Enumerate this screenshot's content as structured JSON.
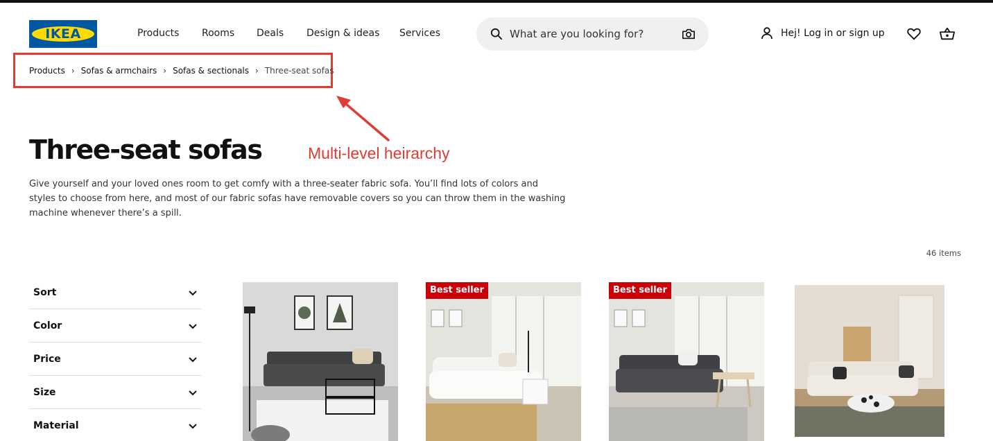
{
  "brand": {
    "logo_text": "IKEA",
    "colors": {
      "blue": "#0058a3",
      "yellow": "#ffdb00",
      "badge_red": "#cc0008",
      "annotation_red": "#e23b32"
    }
  },
  "nav": {
    "items": [
      "Products",
      "Rooms",
      "Deals",
      "Design & ideas",
      "Services"
    ]
  },
  "search": {
    "placeholder": "What are you looking for?",
    "icon": "search-icon",
    "camera_icon": "camera-icon"
  },
  "account": {
    "label": "Hej! Log in or sign up",
    "icon": "user-icon"
  },
  "icons": {
    "favorites": "heart-icon",
    "cart": "shopping-basket-icon"
  },
  "breadcrumb": {
    "items": [
      "Products",
      "Sofas & armchairs",
      "Sofas & sectionals"
    ],
    "current": "Three-seat sofas",
    "separator": "›"
  },
  "annotation": {
    "text": "Multi-level heirarchy"
  },
  "page": {
    "title": "Three-seat sofas",
    "description_lines": [
      "Give yourself and your loved ones room to get comfy with a three-seater fabric sofa. You’ll find lots of colors and",
      "styles to choose from here, and most of our fabric sofas have removable covers so you can throw them in the washing",
      "machine whenever there’s a spill."
    ],
    "item_count": "46 items"
  },
  "filters": [
    "Sort",
    "Color",
    "Price",
    "Size",
    "Material"
  ],
  "products": [
    {
      "badge": "",
      "sofa_color": "dark-gray"
    },
    {
      "badge": "Best seller",
      "sofa_color": "white"
    },
    {
      "badge": "Best seller",
      "sofa_color": "dark-gray"
    },
    {
      "badge": "",
      "sofa_color": "beige"
    }
  ]
}
